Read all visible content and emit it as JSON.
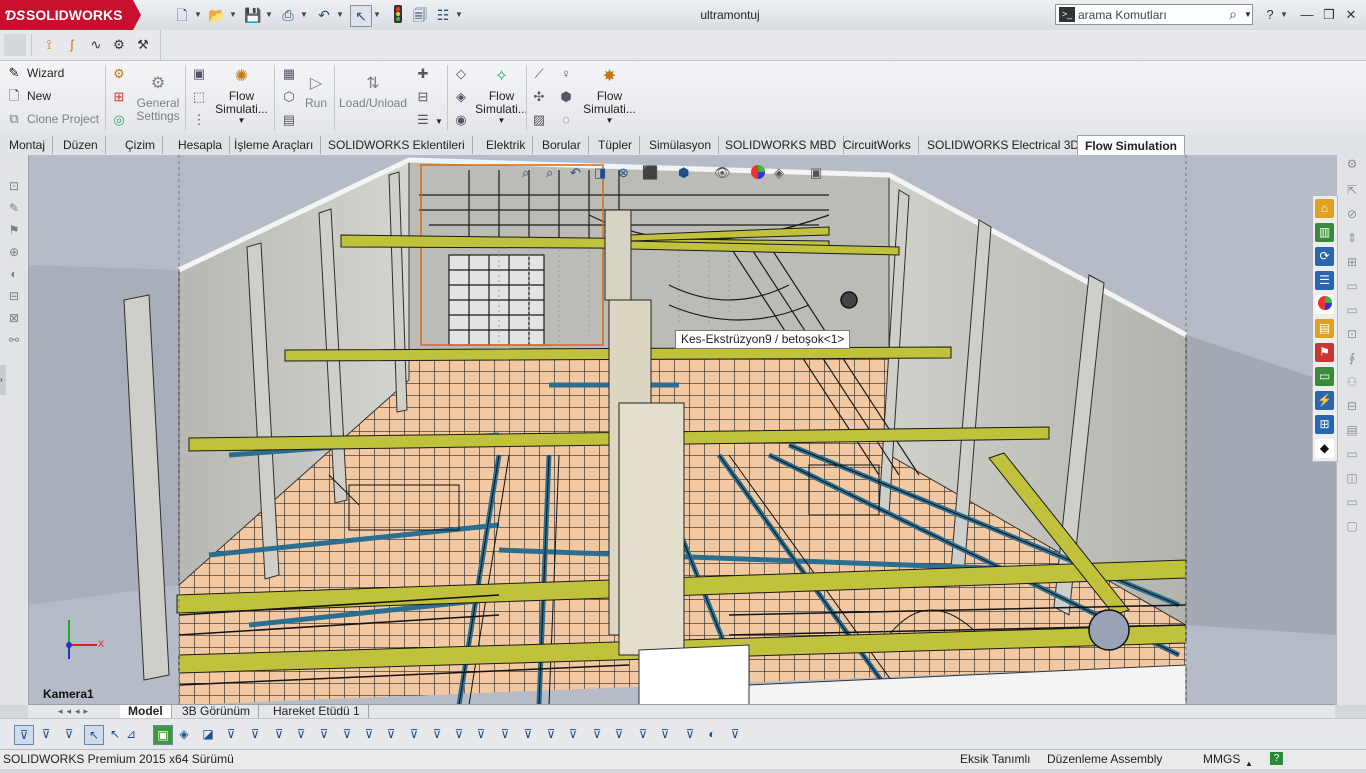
{
  "app": {
    "brand": "SOLIDWORKS",
    "document_title": "ultramontuj"
  },
  "search": {
    "value": "arama Komutları",
    "icon": "magnifier-icon"
  },
  "window_controls": [
    "help",
    "minimize",
    "restore",
    "close"
  ],
  "ribbon": {
    "left_items": [
      {
        "label": "Wizard",
        "icon": "wand-icon",
        "enabled": true
      },
      {
        "label": "New",
        "icon": "new-document-icon",
        "enabled": true
      },
      {
        "label": "Clone Project",
        "icon": "clone-icon",
        "enabled": false
      }
    ],
    "general_settings": "General\nSettings",
    "flow_sim_1": "Flow\nSimulati...",
    "run": "Run",
    "load_unload": "Load/Unload",
    "flow_sim_2": "Flow\nSimulati...",
    "flow_sim_3": "Flow\nSimulati..."
  },
  "tabs": [
    {
      "label": "Montaj",
      "active": false
    },
    {
      "label": "Düzen",
      "active": false
    },
    {
      "label": "Çizim",
      "active": false
    },
    {
      "label": "Hesapla",
      "active": false
    },
    {
      "label": "İşleme Araçları",
      "active": false
    },
    {
      "label": "SOLIDWORKS Eklentileri",
      "active": false
    },
    {
      "label": "Elektrik",
      "active": false
    },
    {
      "label": "Borular",
      "active": false
    },
    {
      "label": "Tüpler",
      "active": false
    },
    {
      "label": "Simülasyon",
      "active": false
    },
    {
      "label": "SOLIDWORKS MBD",
      "active": false
    },
    {
      "label": "CircuitWorks",
      "active": false
    },
    {
      "label": "SOLIDWORKS Electrical 3D",
      "active": false
    },
    {
      "label": "Flow Simulation",
      "active": true
    }
  ],
  "viewport": {
    "tooltip": "Kes-Ekstrüzyon9 / betoşok<1>",
    "camera_label": "Kamera1",
    "triad_x": "X"
  },
  "bottom_tabs": [
    {
      "label": "Model",
      "active": true
    },
    {
      "label": "3B Görünüm",
      "active": false
    },
    {
      "label": "Hareket Etüdü 1",
      "active": false
    }
  ],
  "status": {
    "product": "SOLIDWORKS Premium 2015 x64 Sürümü",
    "definition": "Eksik Tanımlı",
    "mode": "Düzenleme Assembly",
    "units": "MMGS"
  },
  "colors": {
    "brand_red": "#c8102e",
    "beam_yellow": "#bfc23a",
    "floor_peach": "#f2c9a2",
    "rail_blue": "#2a6f92",
    "wall_grey": "#c9c9c4"
  }
}
